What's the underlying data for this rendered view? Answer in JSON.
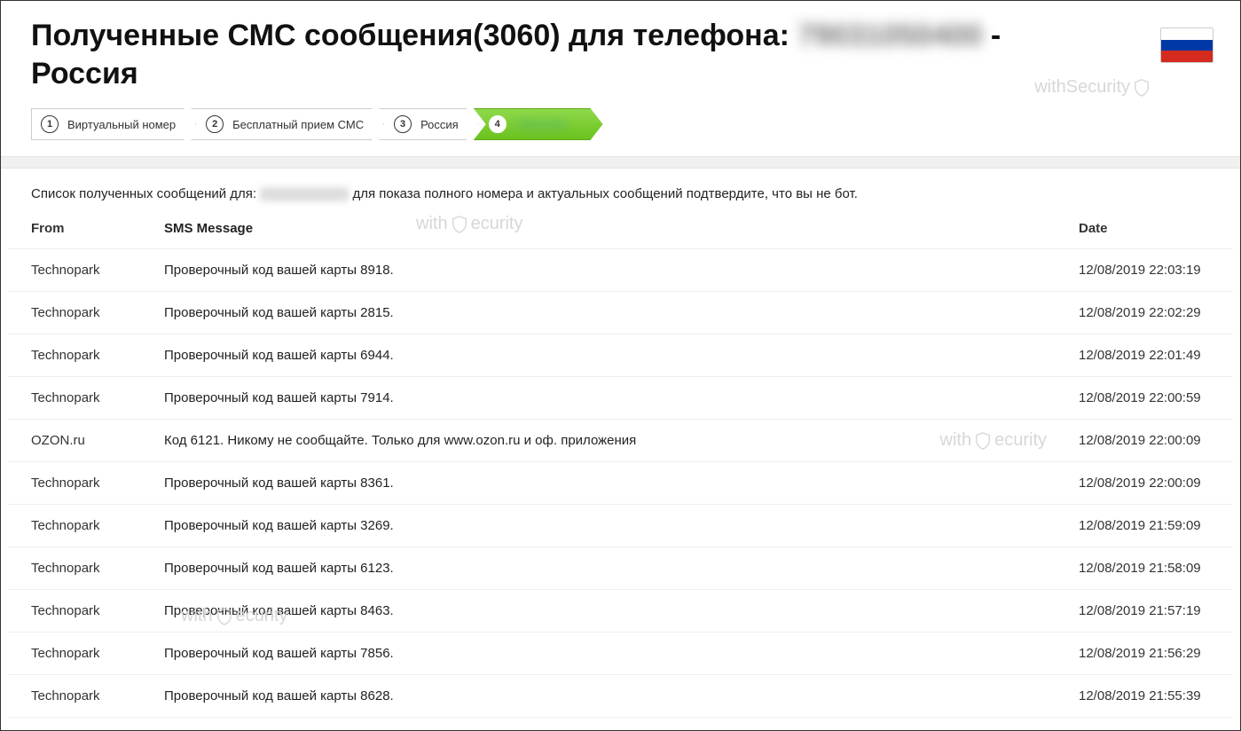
{
  "header": {
    "title_prefix": "Полученные СМС сообщения(3060) для телефона: ",
    "title_phone_masked": "79031050400",
    "title_suffix_1": " -",
    "title_country": "Россия"
  },
  "watermark": "withSecurity",
  "breadcrumb": [
    {
      "num": "1",
      "label": "Виртуальный номер",
      "active": false
    },
    {
      "num": "2",
      "label": "Бесплатный прием СМС",
      "active": false
    },
    {
      "num": "3",
      "label": "Россия",
      "active": false
    },
    {
      "num": "4",
      "label_masked": "79031050",
      "active": true
    }
  ],
  "description": {
    "prefix": "Список полученных сообщений для: ",
    "suffix": " для показа полного номера и актуальных сообщений подтвердите, что вы не бот."
  },
  "table": {
    "headers": {
      "from": "From",
      "message": "SMS Message",
      "date": "Date"
    },
    "rows": [
      {
        "from": "Technopark",
        "message": "Проверочный код вашей карты 8918.",
        "date": "12/08/2019 22:03:19"
      },
      {
        "from": "Technopark",
        "message": "Проверочный код вашей карты 2815.",
        "date": "12/08/2019 22:02:29"
      },
      {
        "from": "Technopark",
        "message": "Проверочный код вашей карты 6944.",
        "date": "12/08/2019 22:01:49"
      },
      {
        "from": "Technopark",
        "message": "Проверочный код вашей карты 7914.",
        "date": "12/08/2019 22:00:59"
      },
      {
        "from": "OZON.ru",
        "message": "Код 6121. Никому не сообщайте. Только для www.ozon.ru и оф. приложения",
        "date": "12/08/2019 22:00:09"
      },
      {
        "from": "Technopark",
        "message": "Проверочный код вашей карты 8361.",
        "date": "12/08/2019 22:00:09"
      },
      {
        "from": "Technopark",
        "message": "Проверочный код вашей карты 3269.",
        "date": "12/08/2019 21:59:09"
      },
      {
        "from": "Technopark",
        "message": "Проверочный код вашей карты 6123.",
        "date": "12/08/2019 21:58:09"
      },
      {
        "from": "Technopark",
        "message": "Проверочный код вашей карты 8463.",
        "date": "12/08/2019 21:57:19"
      },
      {
        "from": "Technopark",
        "message": "Проверочный код вашей карты 7856.",
        "date": "12/08/2019 21:56:29"
      },
      {
        "from": "Technopark",
        "message": "Проверочный код вашей карты 8628.",
        "date": "12/08/2019 21:55:39"
      }
    ]
  }
}
